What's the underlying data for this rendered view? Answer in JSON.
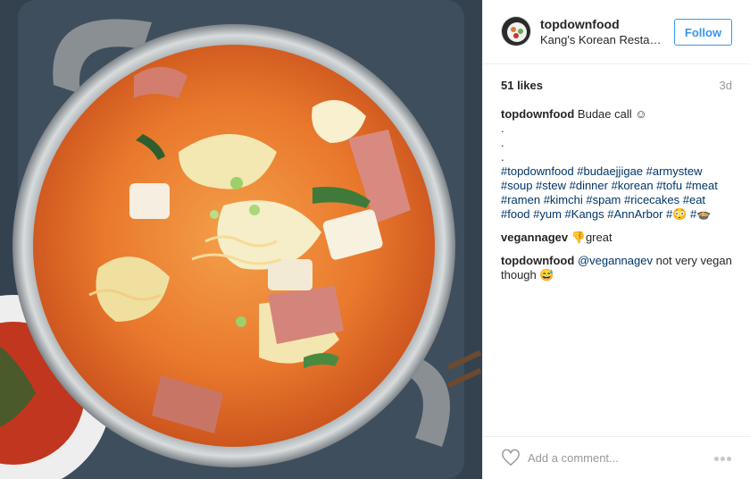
{
  "photo": {
    "alt": "Budae jjigae stew in a metal pot"
  },
  "post": {
    "username": "topdownfood",
    "location": "Kang's Korean Restaurant",
    "follow_label": "Follow",
    "likes": "51 likes",
    "age": "3d"
  },
  "caption": {
    "username": "topdownfood",
    "text": " Budae call ☺",
    "dots": [
      ".",
      ".",
      "."
    ],
    "hashtags": "#topdownfood #budaejjigae #armystew #soup #stew #dinner #korean #tofu #meat #ramen #kimchi #spam #ricecakes #eat #food #yum #Kangs #AnnArbor #😳 #🍲"
  },
  "comments": [
    {
      "username": "vegannagev",
      "text": " 👎great"
    },
    {
      "username": "topdownfood",
      "mention": "@vegannagev",
      "text": " not very vegan though 😅"
    }
  ],
  "add_comment": {
    "placeholder": "Add a comment...",
    "heart_icon": "heart-outline-icon",
    "more_icon": "ellipsis-icon"
  },
  "colors": {
    "accent": "#3897f0",
    "hashtag": "#003569",
    "text": "#262626",
    "muted": "#999999"
  }
}
